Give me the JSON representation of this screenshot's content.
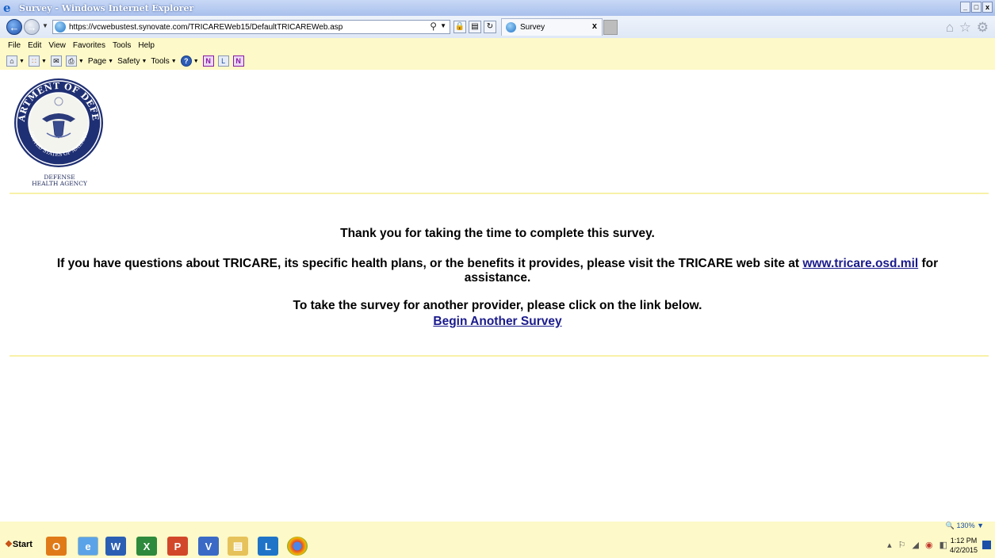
{
  "window": {
    "title": "Survey - Windows Internet Explorer",
    "buttons": [
      "_",
      "Β",
      "x"
    ]
  },
  "browser": {
    "url": "https://vcwebustest.synovate.com/TRICAREWeb15/DefaultTRICAREWeb.asp",
    "tab_label": "Survey",
    "tab_close": "x"
  },
  "menu": [
    "File",
    "Edit",
    "View",
    "Favorites",
    "Tools",
    "Help"
  ],
  "commandbar": {
    "page": "Page",
    "safety": "Safety",
    "tools": "Tools"
  },
  "logo": {
    "seal_text": "DEPARTMENT OF DEFENSE",
    "seal_bottom": "UNITED STATES OF AMERICA",
    "agency_line1": "DEFENSE",
    "agency_line2": "HEALTH AGENCY"
  },
  "main": {
    "thanks": "Thank you for taking the time to complete this survey.",
    "questions_prefix": "If you have questions about TRICARE, its specific health plans, or the benefits it provides, please visit the TRICARE web site at",
    "tricare_link": "www.tricare.osd.mil",
    "questions_suffix": "for",
    "assistance": "assistance.",
    "another": "To take the survey for another provider, please click on the link below.",
    "begin_link": "Begin Another Survey"
  },
  "status": {
    "zoom": "130%"
  },
  "taskbar": {
    "start_label": "Start",
    "time": "1:12 PM",
    "date": "4/2/2015"
  },
  "colors": {
    "chrome_yellow": "#fdf9c8",
    "link": "#1a1a8c"
  }
}
